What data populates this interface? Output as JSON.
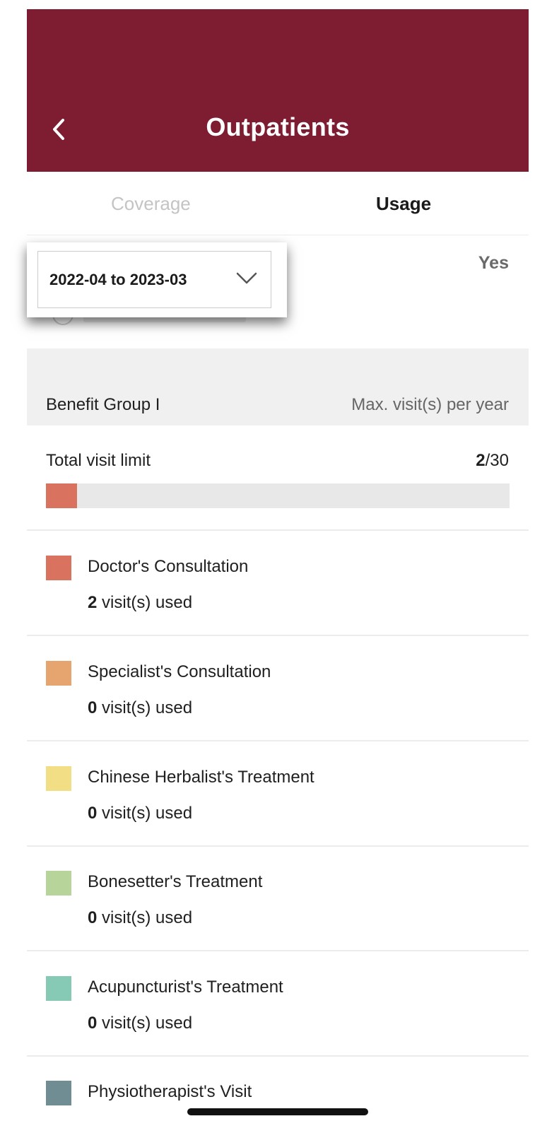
{
  "header": {
    "title": "Outpatients",
    "back_icon": "chevron-left-icon",
    "color": "#7e1c31"
  },
  "tabs": [
    {
      "label": "Coverage",
      "active": false
    },
    {
      "label": "Usage",
      "active": true
    }
  ],
  "period_select": {
    "value": "2022-04 to 2023-03",
    "icon": "chevron-down-icon"
  },
  "behind_value": "Yes",
  "benefit_group": {
    "name": "Benefit Group I",
    "limit_label": "Max. visit(s) per year"
  },
  "total": {
    "label": "Total visit limit",
    "used": "2",
    "max": "/30",
    "progress": 0.0667,
    "bar_color": "#d9725f"
  },
  "used_suffix": " visit(s) used",
  "items": [
    {
      "label": "Doctor's Consultation",
      "used": "2",
      "color": "#d9725f"
    },
    {
      "label": "Specialist's Consultation",
      "used": "0",
      "color": "#e6a56e"
    },
    {
      "label": "Chinese Herbalist's Treatment",
      "used": "0",
      "color": "#f2de85"
    },
    {
      "label": "Bonesetter's Treatment",
      "used": "0",
      "color": "#b7d49a"
    },
    {
      "label": "Acupuncturist's Treatment",
      "used": "0",
      "color": "#86cab6"
    },
    {
      "label": "Physiotherapist's Visit",
      "used": "",
      "color": "#6f8d93"
    }
  ]
}
